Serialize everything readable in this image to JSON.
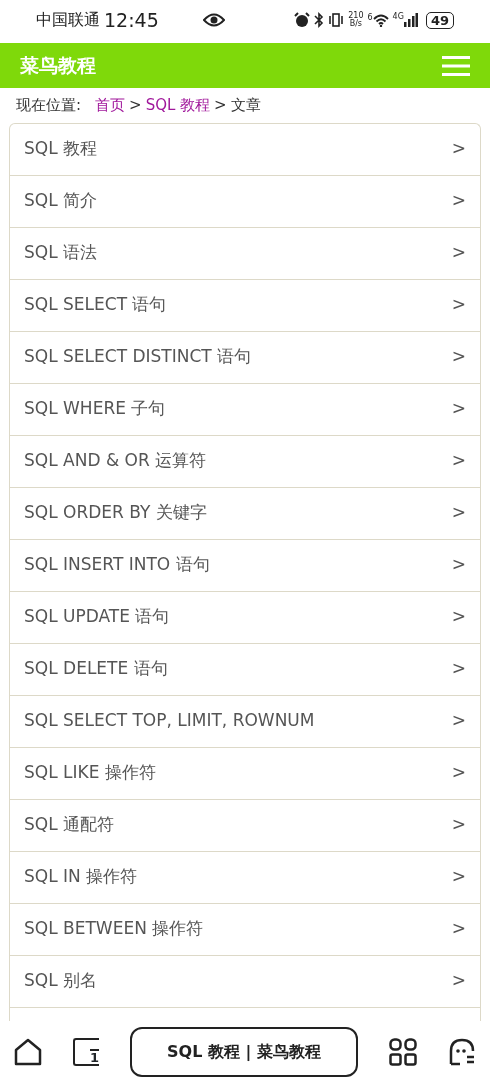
{
  "status_bar": {
    "carrier": "中国联通",
    "time": "12:45",
    "net_speed": "210",
    "net_speed_unit": "B/s",
    "wifi_label": "6",
    "cell_label": "4G",
    "battery": "49"
  },
  "navbar": {
    "brand": "菜鸟教程"
  },
  "breadcrumb": {
    "label": "现在位置:",
    "items": [
      {
        "text": "首页",
        "kind": "link"
      },
      {
        "text": ">",
        "kind": "sep"
      },
      {
        "text": "SQL 教程",
        "kind": "link"
      },
      {
        "text": ">",
        "kind": "sep"
      },
      {
        "text": "文章",
        "kind": "current"
      }
    ]
  },
  "menu": [
    {
      "text": "SQL 教程",
      "arrow": ">"
    },
    {
      "text": "SQL 简介",
      "arrow": ">"
    },
    {
      "text": "SQL 语法",
      "arrow": ">"
    },
    {
      "text": "SQL SELECT 语句",
      "arrow": ">"
    },
    {
      "text": "SQL SELECT DISTINCT 语句",
      "arrow": ">"
    },
    {
      "text": "SQL WHERE 子句",
      "arrow": ">"
    },
    {
      "text": "SQL AND & OR 运算符",
      "arrow": ">"
    },
    {
      "text": "SQL ORDER BY 关键字",
      "arrow": ">"
    },
    {
      "text": "SQL INSERT INTO 语句",
      "arrow": ">"
    },
    {
      "text": "SQL UPDATE 语句",
      "arrow": ">"
    },
    {
      "text": "SQL DELETE 语句",
      "arrow": ">"
    },
    {
      "text": "SQL SELECT TOP, LIMIT, ROWNUM",
      "arrow": ">"
    },
    {
      "text": "SQL LIKE 操作符",
      "arrow": ">"
    },
    {
      "text": "SQL 通配符",
      "arrow": ">"
    },
    {
      "text": "SQL IN 操作符",
      "arrow": ">"
    },
    {
      "text": "SQL BETWEEN 操作符",
      "arrow": ">"
    },
    {
      "text": "SQL 别名",
      "arrow": ">"
    }
  ],
  "browser_bar": {
    "tab_count": "1",
    "title": "SQL 教程 | 菜鸟教程"
  }
}
